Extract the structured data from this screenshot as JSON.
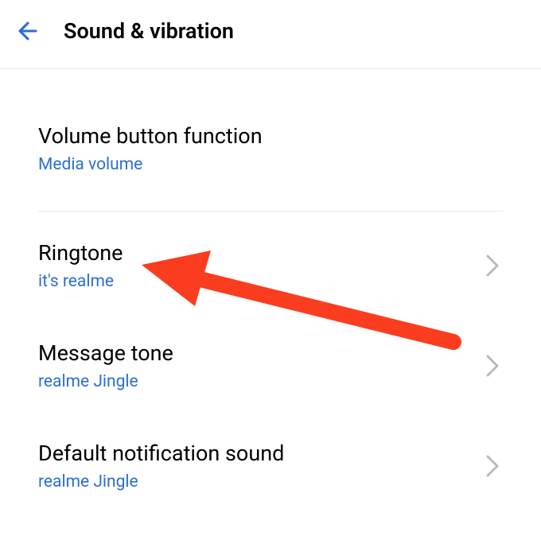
{
  "header": {
    "title": "Sound & vibration"
  },
  "settings": {
    "volumeButton": {
      "title": "Volume button function",
      "value": "Media volume"
    },
    "ringtone": {
      "title": "Ringtone",
      "value": "it's realme"
    },
    "messageTone": {
      "title": "Message tone",
      "value": "realme Jingle"
    },
    "defaultNotification": {
      "title": "Default notification sound",
      "value": "realme Jingle"
    }
  }
}
